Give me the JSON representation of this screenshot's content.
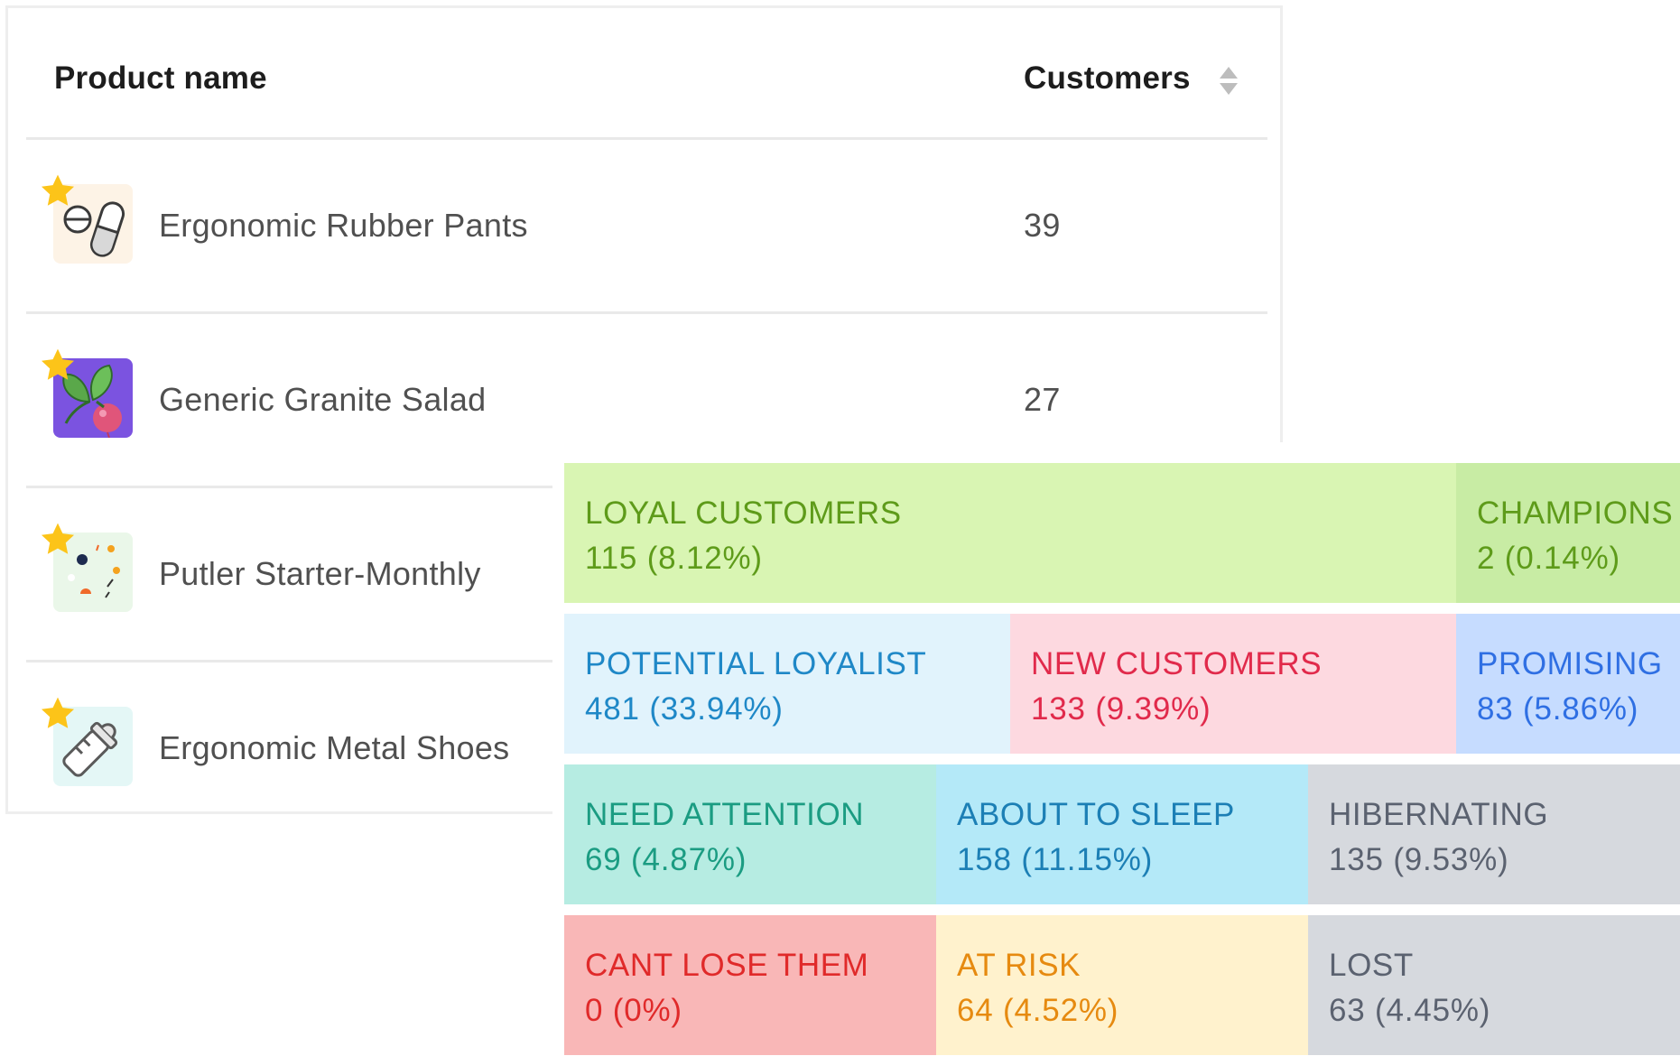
{
  "table": {
    "headers": {
      "name": "Product name",
      "customers": "Customers"
    },
    "rows": [
      {
        "name": "Ergonomic Rubber Pants",
        "customers": "39",
        "icon": "pills-icon"
      },
      {
        "name": "Generic Granite Salad",
        "customers": "27",
        "icon": "radish-icon"
      },
      {
        "name": "Putler Starter-Monthly",
        "customers": "",
        "icon": "confetti-icon"
      },
      {
        "name": "Ergonomic Metal Shoes",
        "customers": "",
        "icon": "baby-bottle-icon"
      }
    ]
  },
  "segments": [
    {
      "name": "LOYAL CUSTOMERS",
      "value": "115 (8.12%)",
      "bg": "#d9f5b3",
      "fg": "#5e9b1a"
    },
    {
      "name": "CHAMPIONS",
      "value": "2 (0.14%)",
      "bg": "#c8eca4",
      "fg": "#5e9b1a"
    },
    {
      "name": "POTENTIAL LOYALIST",
      "value": "481 (33.94%)",
      "bg": "#e1f3fc",
      "fg": "#1f88c7"
    },
    {
      "name": "NEW CUSTOMERS",
      "value": "133 (9.39%)",
      "bg": "#fdd9e0",
      "fg": "#e12a4b"
    },
    {
      "name": "PROMISING",
      "value": "83 (5.86%)",
      "bg": "#c6dcff",
      "fg": "#2f6fe3"
    },
    {
      "name": "NEED ATTENTION",
      "value": "69 (4.87%)",
      "bg": "#b6ece2",
      "fg": "#1b9c82"
    },
    {
      "name": "ABOUT TO SLEEP",
      "value": "158 (11.15%)",
      "bg": "#b4e9f8",
      "fg": "#1c7fb5"
    },
    {
      "name": "HIBERNATING",
      "value": "135 (9.53%)",
      "bg": "#d6d9de",
      "fg": "#5b6270"
    },
    {
      "name": "CANT LOSE THEM",
      "value": "0 (0%)",
      "bg": "#f9b7b7",
      "fg": "#e02a2a"
    },
    {
      "name": "AT RISK",
      "value": "64 (4.52%)",
      "bg": "#fff2cd",
      "fg": "#e68a10"
    },
    {
      "name": "LOST",
      "value": "63 (4.45%)",
      "bg": "#d6d9de",
      "fg": "#5b6270"
    }
  ]
}
